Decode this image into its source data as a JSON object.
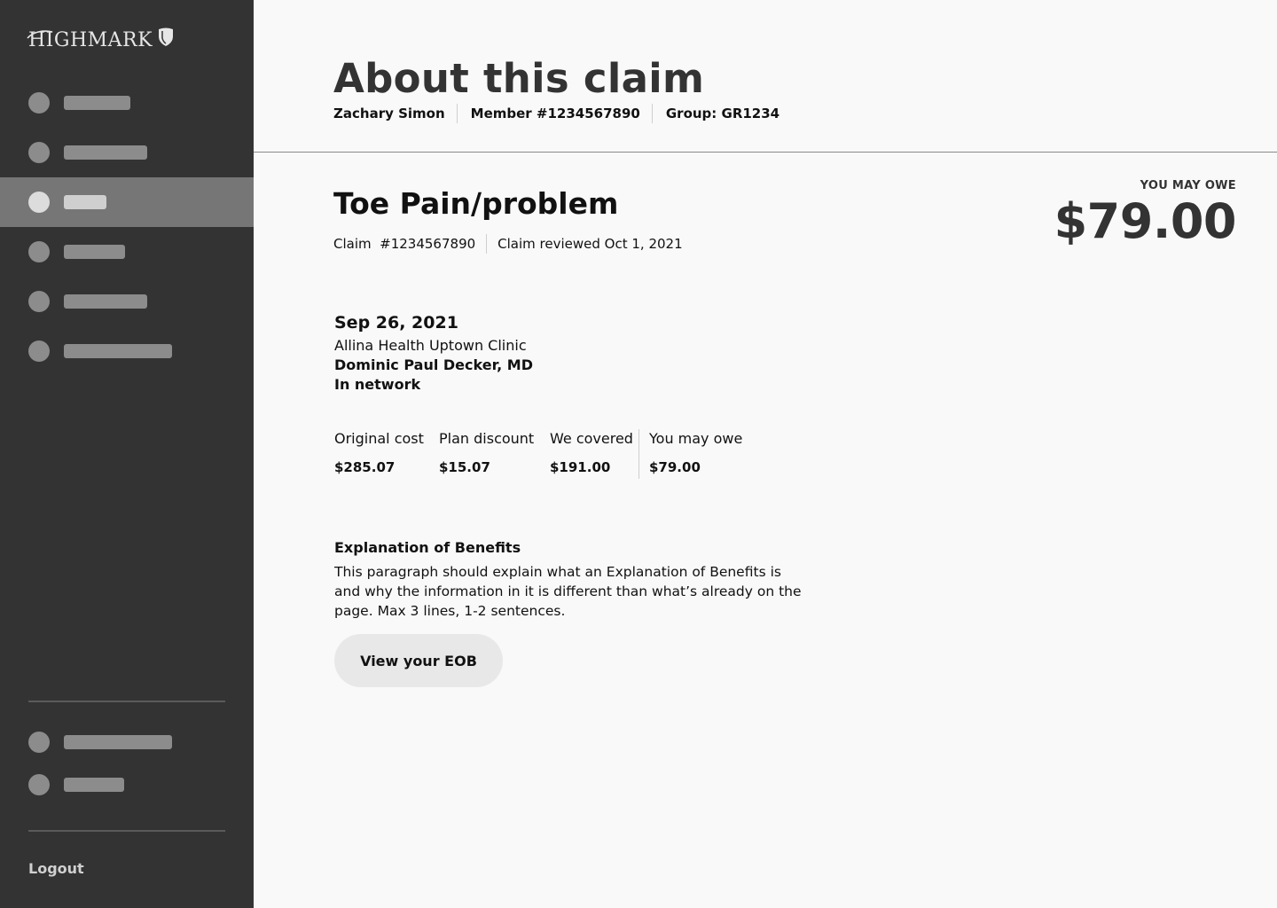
{
  "brand": {
    "name": "HIGHMARK"
  },
  "sidebar": {
    "nav_items": [
      {
        "id": "nav-1",
        "active": false
      },
      {
        "id": "nav-2",
        "active": false
      },
      {
        "id": "nav-3",
        "active": true
      },
      {
        "id": "nav-4",
        "active": false
      },
      {
        "id": "nav-5",
        "active": false
      },
      {
        "id": "nav-6",
        "active": false
      }
    ],
    "secondary_items": [
      {
        "id": "secondary-1"
      },
      {
        "id": "secondary-2"
      }
    ],
    "logout_label": "Logout"
  },
  "header": {
    "title": "About this claim",
    "member_name": "Zachary Simon",
    "member_number": "Member #1234567890",
    "group": "Group: GR1234"
  },
  "claim": {
    "title": "Toe Pain/problem",
    "number": "Claim  #1234567890",
    "reviewed": "Claim reviewed Oct 1, 2021",
    "owe_label": "YOU MAY OWE",
    "owe_amount": "$79.00"
  },
  "visit": {
    "date": "Sep 26, 2021",
    "clinic": "Allina Health Uptown Clinic",
    "doctor": "Dominic Paul Decker, MD",
    "network": "In network"
  },
  "costs": [
    {
      "label": "Original cost",
      "value": "$285.07"
    },
    {
      "label": "Plan discount",
      "value": "$15.07"
    },
    {
      "label": "We covered",
      "value": "$191.00"
    },
    {
      "label": "You may owe",
      "value": "$79.00"
    }
  ],
  "eob": {
    "title": "Explanation of Benefits",
    "text": "This paragraph should explain what an Explanation of Benefits is and why the information in it is different than what’s already on the page. Max 3 lines, 1-2 sentences.",
    "button_label": "View your EOB"
  },
  "colors": {
    "sidebar_bg": "#333333",
    "sidebar_active": "#767676",
    "page_bg": "#f9f9f9",
    "button_bg": "#e8e8e8"
  }
}
